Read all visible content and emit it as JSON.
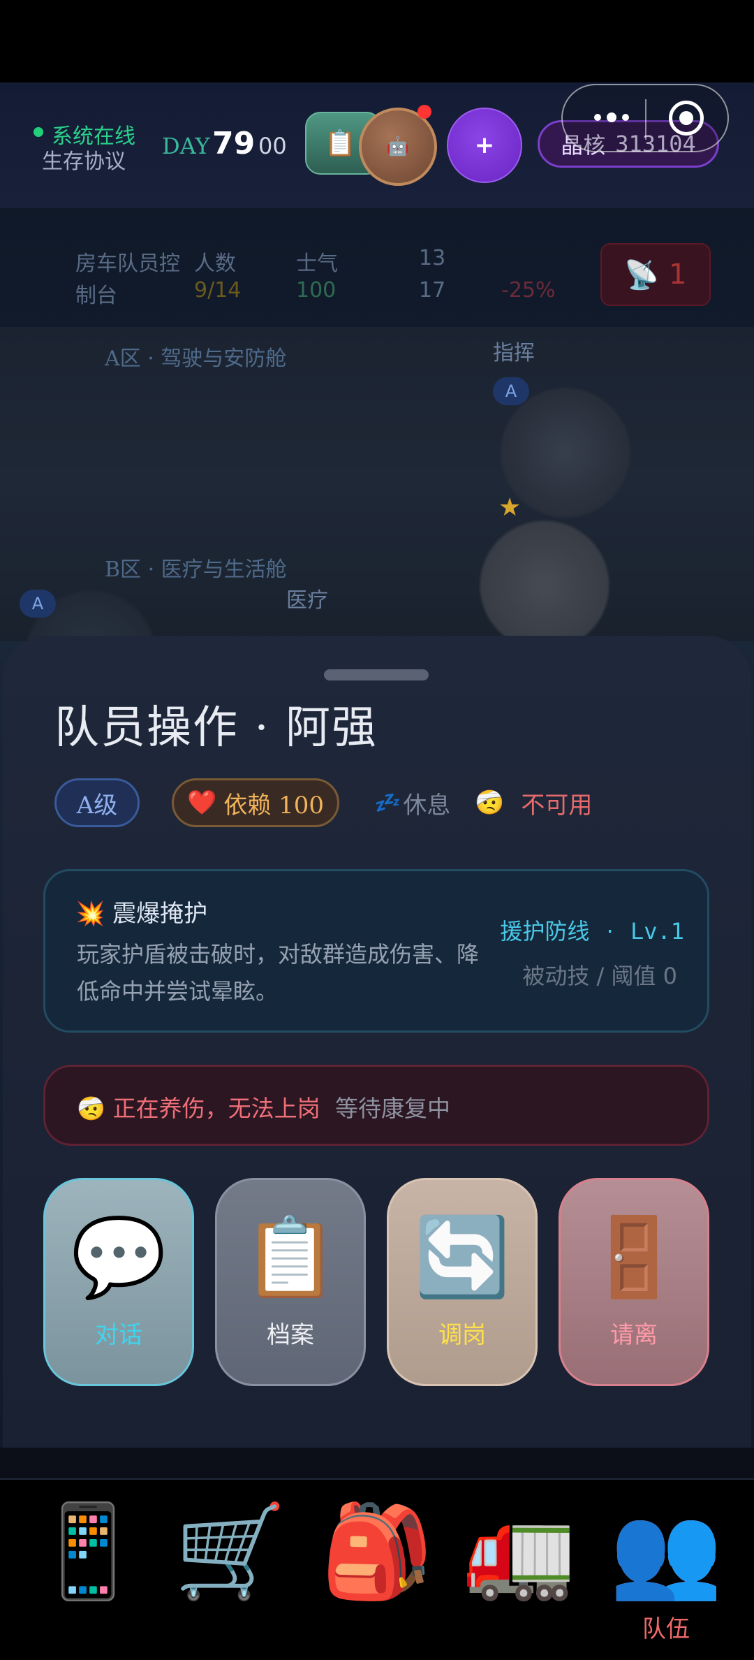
{
  "header": {
    "status_online": "系统在线",
    "protocol": "生存协议",
    "day_label": "DAY",
    "day_number": "79",
    "day_sub": "00",
    "crystal_label": "晶核",
    "crystal_value": "313104",
    "quest_icon": "📋",
    "robot_icon": "🤖",
    "plus_label": "+"
  },
  "background": {
    "team_label": "房车队员控",
    "team_sub": "制台",
    "count_label": "人数",
    "count_value": "9/14",
    "morale_label": "士气",
    "morale_value": "100",
    "stat_a": "13",
    "stat_b": "17",
    "modifier_value": "-25%",
    "radio_count": "1",
    "zone_a": "A区 · 驾驶与安防舱",
    "zone_b": "B区 · 医疗与生活舱",
    "command_label": "指挥",
    "medical_label": "医疗",
    "grade_a": "A",
    "grade_b": "A"
  },
  "sheet": {
    "title": "队员操作 · 阿强",
    "tag_grade": "A级",
    "tag_trust_icon": "❤️",
    "tag_trust": "依赖 100",
    "tag_rest_icon": "💤",
    "tag_rest": "休息",
    "tag_unavail_icon": "🤕",
    "tag_unavail": "不可用",
    "skill": {
      "icon": "💥",
      "name": "震爆掩护",
      "desc": "玩家护盾被击破时，对敌群造成伤害、降低命中并尝试晕眩。",
      "line": "援护防线",
      "dot": "·",
      "level": "Lv.1",
      "passive": "被动技 / 阈值 0"
    },
    "warning": {
      "icon": "🤕",
      "text": "正在养伤，无法上岗",
      "sub": "等待康复中"
    },
    "actions": [
      {
        "icon": "💬",
        "label": "对话"
      },
      {
        "icon": "📋",
        "label": "档案"
      },
      {
        "icon": "🔄",
        "label": "调岗"
      },
      {
        "icon": "🚪",
        "label": "请离"
      }
    ]
  },
  "nav": {
    "items": [
      {
        "icon": "📱",
        "label": ""
      },
      {
        "icon": "🛒",
        "label": ""
      },
      {
        "icon": "🎒",
        "label": ""
      },
      {
        "icon": "🚛",
        "label": ""
      },
      {
        "icon": "👥",
        "label": "队伍"
      }
    ]
  }
}
